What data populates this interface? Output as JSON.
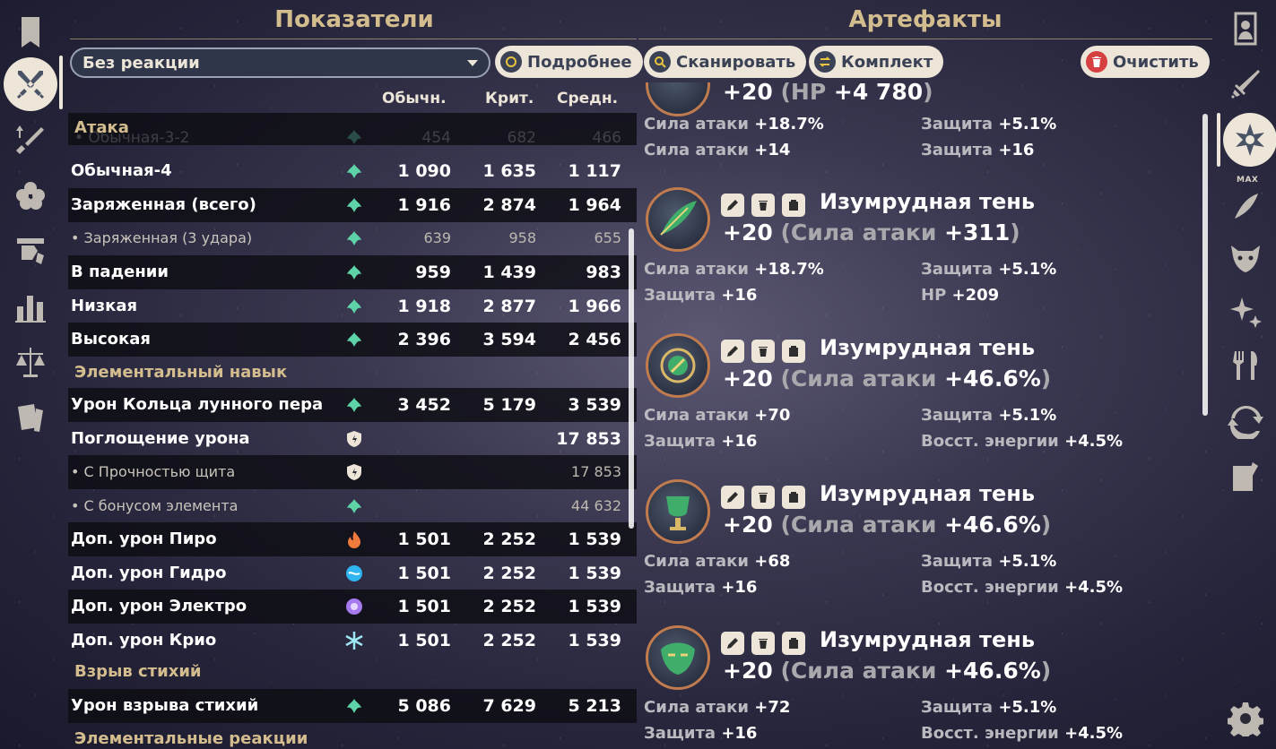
{
  "headers": {
    "stats": "Показатели",
    "artifacts": "Артефакты"
  },
  "controls": {
    "reaction_select": "Без реакции",
    "details": "Подробнее",
    "scan": "Сканировать",
    "set": "Комплект",
    "clear": "Очистить"
  },
  "columns": {
    "normal": "Обычн.",
    "crit": "Крит.",
    "avg": "Средн."
  },
  "stats": {
    "cat_attack": "Атака",
    "faded_row": {
      "name": "• Обычная-3-2",
      "v1": "454",
      "v2": "682",
      "v3": "466"
    },
    "rows": [
      {
        "name": "Обычная-4",
        "v1": "1 090",
        "v2": "1 635",
        "v3": "1 117"
      },
      {
        "name": "Заряженная (всего)",
        "v1": "1 916",
        "v2": "2 874",
        "v3": "1 964"
      },
      {
        "name": "• Заряженная (3 удара)",
        "v1": "639",
        "v2": "958",
        "v3": "655"
      },
      {
        "name": "В падении",
        "v1": "959",
        "v2": "1 439",
        "v3": "983"
      },
      {
        "name": "Низкая",
        "v1": "1 918",
        "v2": "2 877",
        "v3": "1 966"
      },
      {
        "name": "Высокая",
        "v1": "2 396",
        "v2": "3 594",
        "v3": "2 456"
      },
      {
        "name": "Урон Кольца лунного пера",
        "v1": "3 452",
        "v2": "5 179",
        "v3": "3 539"
      },
      {
        "name": "Поглощение урона",
        "v3": "17 853"
      },
      {
        "name": "• С Прочностью щита",
        "v3": "17 853"
      },
      {
        "name": "• С бонусом элемента",
        "v3": "44 632"
      },
      {
        "name": "Доп. урон Пиро",
        "v1": "1 501",
        "v2": "2 252",
        "v3": "1 539"
      },
      {
        "name": "Доп. урон Гидро",
        "v1": "1 501",
        "v2": "2 252",
        "v3": "1 539"
      },
      {
        "name": "Доп. урон Электро",
        "v1": "1 501",
        "v2": "2 252",
        "v3": "1 539"
      },
      {
        "name": "Доп. урон Крио",
        "v1": "1 501",
        "v2": "2 252",
        "v3": "1 539"
      },
      {
        "name": "Урон взрыва стихий",
        "v1": "5 086",
        "v2": "7 629",
        "v3": "5 213"
      }
    ],
    "cat_skill": "Элементальный навык",
    "cat_burst": "Взрыв стихий",
    "cat_reactions": "Элементальные реакции"
  },
  "artifacts": {
    "partial": {
      "level": "+20",
      "main_stat": "HP",
      "main_value": "+4 780",
      "subs": [
        {
          "k": "Сила атаки",
          "v": "+18.7%"
        },
        {
          "k": "Защита",
          "v": "+5.1%"
        },
        {
          "k": "Сила атаки",
          "v": "+14"
        },
        {
          "k": "Защита",
          "v": "+16"
        }
      ]
    },
    "items": [
      {
        "name": "Изумрудная тень",
        "level": "+20",
        "main_stat": "Сила атаки",
        "main_value": "+311",
        "subs": [
          {
            "k": "Сила атаки",
            "v": "+18.7%"
          },
          {
            "k": "Защита",
            "v": "+5.1%"
          },
          {
            "k": "Защита",
            "v": "+16"
          },
          {
            "k": "HP",
            "v": "+209"
          }
        ]
      },
      {
        "name": "Изумрудная тень",
        "level": "+20",
        "main_stat": "Сила атаки",
        "main_value": "+46.6%",
        "subs": [
          {
            "k": "Сила атаки",
            "v": "+70"
          },
          {
            "k": "Защита",
            "v": "+5.1%"
          },
          {
            "k": "Защита",
            "v": "+16"
          },
          {
            "k": "Восст. энергии",
            "v": "+4.5%"
          }
        ]
      },
      {
        "name": "Изумрудная тень",
        "level": "+20",
        "main_stat": "Сила атаки",
        "main_value": "+46.6%",
        "subs": [
          {
            "k": "Сила атаки",
            "v": "+68"
          },
          {
            "k": "Защита",
            "v": "+5.1%"
          },
          {
            "k": "Защита",
            "v": "+16"
          },
          {
            "k": "Восст. энергии",
            "v": "+4.5%"
          }
        ]
      },
      {
        "name": "Изумрудная тень",
        "level": "+20",
        "main_stat": "Сила атаки",
        "main_value": "+46.6%",
        "subs": [
          {
            "k": "Сила атаки",
            "v": "+72"
          },
          {
            "k": "Защита",
            "v": "+5.1%"
          },
          {
            "k": "Защита",
            "v": "+16"
          },
          {
            "k": "Восст. энергии",
            "v": "+4.5%"
          }
        ]
      }
    ]
  },
  "right_sidebar": {
    "max_label": "MAX"
  },
  "colors": {
    "gold": "#d3bc8e",
    "cream": "#ece5d8",
    "anemo": "#5fd3a8",
    "pyro": "#f07a3c",
    "hydro": "#2fb5f0",
    "electro": "#a77bf0",
    "cryo": "#9fe6f5"
  }
}
